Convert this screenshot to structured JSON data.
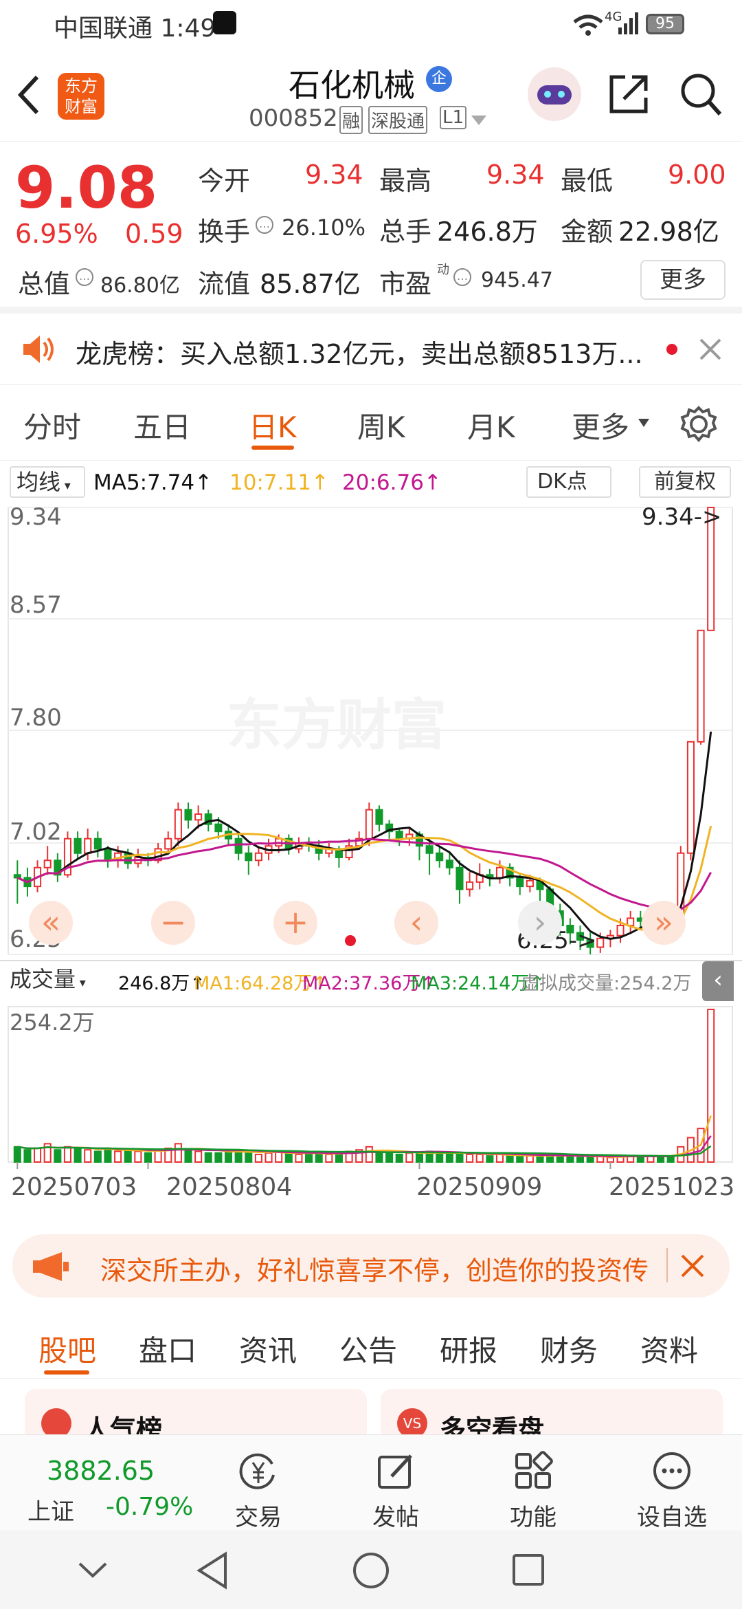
{
  "status_bar": {
    "carrier_time": "中国联通 1:49",
    "network": "4G",
    "battery": "95"
  },
  "header": {
    "logo_line1": "东方",
    "logo_line2": "财富",
    "stock_name": "石化机械",
    "corp_badge": "企",
    "stock_code": "000852",
    "tags": [
      "融",
      "深股通",
      "L1"
    ]
  },
  "quote": {
    "price": "9.08",
    "change_pct": "6.95%",
    "change_amt": "0.59",
    "open_label": "今开",
    "open": "9.34",
    "high_label": "最高",
    "high": "9.34",
    "low_label": "最低",
    "low": "9.00",
    "turnover_label": "换手",
    "turnover": "26.10%",
    "volume_label": "总手",
    "volume": "246.8万",
    "amount_label": "金额",
    "amount": "22.98亿",
    "mktcap_label": "总值",
    "mktcap": "86.80亿",
    "float_label": "流值",
    "float_cap": "85.87亿",
    "pe_label": "市盈",
    "pe_sup": "动",
    "pe": "945.47",
    "more_button": "更多"
  },
  "notice": {
    "text": "龙虎榜：买入总额1.32亿元，卖出总额8513万..."
  },
  "kline_tabs": [
    "分时",
    "五日",
    "日K",
    "周K",
    "月K",
    "更多"
  ],
  "kline_active": "日K",
  "chart_toolbar": {
    "ma_selector": "均线",
    "ma5": "MA5:7.74",
    "ma10": "10:7.11",
    "ma20": "20:6.76",
    "dk_button": "DK点",
    "adjust_button": "前复权"
  },
  "price_axis": [
    "9.34",
    "8.57",
    "7.80",
    "7.02",
    "6.25"
  ],
  "price_markers": {
    "high": "9.34->",
    "low": "6.25->"
  },
  "watermark": "东方财富",
  "volume_toolbar": {
    "selector": "成交量",
    "vol": "246.8万",
    "ma1": "MA1:64.28万",
    "ma2": "MA2:37.36万",
    "ma3": "MA3:24.14万",
    "virtual": "虚拟成交量:254.2万"
  },
  "volume_axis_max": "254.2万",
  "dates": [
    "20250703",
    "20250804",
    "20250909",
    "20251023"
  ],
  "colors": {
    "up": "#e93030",
    "down": "#119a2b",
    "ma5": "#111111",
    "ma10": "#f0b323",
    "ma20": "#c2188f",
    "accent": "#e8590c"
  },
  "chart_data": {
    "type": "candlestick",
    "ylim": [
      6.25,
      9.34
    ],
    "last_close": 9.08,
    "ma_values": {
      "ma5": 7.74,
      "ma10": 7.11,
      "ma20": 6.76
    },
    "candles": [
      [
        6.8,
        6.78,
        6.9,
        6.6
      ],
      [
        6.78,
        6.72,
        6.85,
        6.65
      ],
      [
        6.72,
        6.85,
        6.9,
        6.68
      ],
      [
        6.85,
        6.9,
        7.0,
        6.8
      ],
      [
        6.9,
        6.8,
        6.95,
        6.75
      ],
      [
        6.8,
        7.05,
        7.1,
        6.78
      ],
      [
        7.05,
        6.95,
        7.1,
        6.9
      ],
      [
        6.95,
        7.05,
        7.12,
        6.9
      ],
      [
        7.05,
        6.98,
        7.1,
        6.92
      ],
      [
        6.98,
        6.9,
        7.0,
        6.85
      ],
      [
        6.9,
        6.95,
        7.0,
        6.85
      ],
      [
        6.95,
        6.88,
        6.98,
        6.84
      ],
      [
        6.88,
        6.92,
        6.98,
        6.85
      ],
      [
        6.92,
        6.9,
        6.95,
        6.86
      ],
      [
        6.9,
        6.98,
        7.02,
        6.88
      ],
      [
        6.98,
        7.05,
        7.1,
        6.95
      ],
      [
        7.05,
        7.25,
        7.3,
        7.0
      ],
      [
        7.25,
        7.18,
        7.3,
        7.12
      ],
      [
        7.18,
        7.22,
        7.28,
        7.12
      ],
      [
        7.22,
        7.15,
        7.25,
        7.1
      ],
      [
        7.15,
        7.1,
        7.2,
        7.05
      ],
      [
        7.1,
        7.05,
        7.15,
        7.0
      ],
      [
        7.05,
        6.95,
        7.08,
        6.9
      ],
      [
        6.95,
        6.9,
        7.0,
        6.8
      ],
      [
        6.9,
        6.95,
        7.0,
        6.86
      ],
      [
        6.95,
        7.0,
        7.05,
        6.9
      ],
      [
        7.0,
        7.05,
        7.08,
        6.95
      ],
      [
        7.05,
        6.98,
        7.08,
        6.94
      ],
      [
        6.98,
        7.02,
        7.06,
        6.95
      ],
      [
        7.02,
        7.0,
        7.06,
        6.96
      ],
      [
        7.0,
        6.95,
        7.04,
        6.9
      ],
      [
        6.95,
        6.98,
        7.02,
        6.92
      ],
      [
        6.98,
        6.92,
        7.0,
        6.85
      ],
      [
        6.92,
        7.0,
        7.05,
        6.9
      ],
      [
        7.0,
        7.05,
        7.1,
        6.98
      ],
      [
        7.05,
        7.25,
        7.3,
        7.0
      ],
      [
        7.25,
        7.15,
        7.28,
        7.1
      ],
      [
        7.15,
        7.1,
        7.18,
        7.05
      ],
      [
        7.1,
        7.05,
        7.12,
        7.0
      ],
      [
        7.05,
        7.08,
        7.12,
        7.0
      ],
      [
        7.08,
        7.0,
        7.1,
        6.9
      ],
      [
        7.0,
        6.95,
        7.05,
        6.8
      ],
      [
        6.95,
        6.9,
        7.0,
        6.85
      ],
      [
        6.9,
        6.85,
        6.95,
        6.8
      ],
      [
        6.85,
        6.7,
        6.9,
        6.6
      ],
      [
        6.7,
        6.75,
        6.82,
        6.65
      ],
      [
        6.75,
        6.8,
        6.88,
        6.7
      ],
      [
        6.8,
        6.78,
        6.84,
        6.72
      ],
      [
        6.78,
        6.85,
        6.9,
        6.74
      ],
      [
        6.85,
        6.78,
        6.88,
        6.72
      ],
      [
        6.78,
        6.72,
        6.8,
        6.66
      ],
      [
        6.72,
        6.76,
        6.8,
        6.68
      ],
      [
        6.76,
        6.7,
        6.78,
        6.6
      ],
      [
        6.7,
        6.55,
        6.72,
        6.45
      ],
      [
        6.55,
        6.45,
        6.6,
        6.38
      ],
      [
        6.45,
        6.4,
        6.5,
        6.32
      ],
      [
        6.4,
        6.35,
        6.45,
        6.28
      ],
      [
        6.35,
        6.3,
        6.4,
        6.25
      ],
      [
        6.3,
        6.36,
        6.4,
        6.26
      ],
      [
        6.36,
        6.38,
        6.42,
        6.3
      ],
      [
        6.38,
        6.45,
        6.5,
        6.33
      ],
      [
        6.45,
        6.5,
        6.55,
        6.4
      ],
      [
        6.5,
        6.48,
        6.55,
        6.42
      ],
      [
        6.48,
        6.52,
        6.58,
        6.44
      ],
      [
        6.52,
        6.48,
        6.56,
        6.42
      ],
      [
        6.48,
        6.45,
        6.52,
        6.4
      ],
      [
        6.45,
        6.95,
        7.0,
        6.45
      ],
      [
        6.95,
        7.72,
        7.72,
        6.9
      ],
      [
        7.72,
        8.49,
        8.49,
        7.7
      ],
      [
        8.49,
        9.34,
        9.34,
        8.49
      ]
    ],
    "volumes": [
      0.1,
      0.08,
      0.09,
      0.12,
      0.08,
      0.1,
      0.09,
      0.08,
      0.07,
      0.09,
      0.07,
      0.08,
      0.07,
      0.06,
      0.08,
      0.09,
      0.12,
      0.08,
      0.07,
      0.06,
      0.06,
      0.07,
      0.08,
      0.06,
      0.05,
      0.06,
      0.07,
      0.06,
      0.05,
      0.05,
      0.06,
      0.05,
      0.06,
      0.07,
      0.08,
      0.1,
      0.07,
      0.06,
      0.05,
      0.06,
      0.06,
      0.07,
      0.06,
      0.05,
      0.06,
      0.05,
      0.05,
      0.04,
      0.05,
      0.04,
      0.04,
      0.04,
      0.04,
      0.05,
      0.04,
      0.04,
      0.03,
      0.03,
      0.04,
      0.03,
      0.04,
      0.04,
      0.04,
      0.04,
      0.04,
      0.04,
      0.1,
      0.16,
      0.22,
      1.0
    ]
  },
  "sub_tabs": [
    "股吧",
    "盘口",
    "资讯",
    "公告",
    "研报",
    "财务",
    "资料"
  ],
  "sub_active": "股吧",
  "cards": {
    "left": "人气榜",
    "right": "多空看盘"
  },
  "banner": {
    "text": "深交所主办，好礼惊喜享不停，创造你的投资传"
  },
  "bottom_nav": {
    "index_value": "3882.65",
    "index_name": "上证",
    "index_change": "-0.79%",
    "trade": "交易",
    "post": "发帖",
    "func": "功能",
    "watch": "设自选"
  }
}
